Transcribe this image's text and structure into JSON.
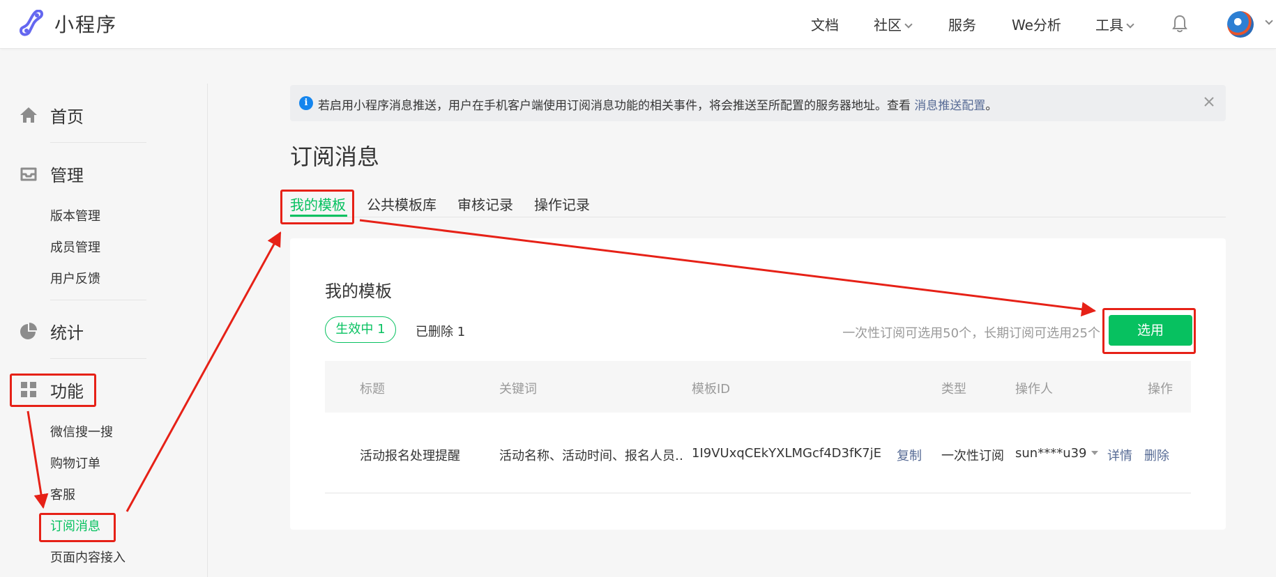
{
  "header": {
    "brand": "小程序",
    "nav": [
      {
        "label": "文档"
      },
      {
        "label": "社区"
      },
      {
        "label": "服务"
      },
      {
        "label": "We分析"
      },
      {
        "label": "工具"
      }
    ]
  },
  "sidebar": {
    "home": "首页",
    "manage": "管理",
    "manage_items": [
      "版本管理",
      "成员管理",
      "用户反馈"
    ],
    "stats": "统计",
    "features": "功能",
    "feature_items": [
      "微信搜一搜",
      "购物订单",
      "客服",
      "订阅消息",
      "页面内容接入"
    ]
  },
  "notice": {
    "text": "若启用小程序消息推送，用户在手机客户端使用订阅消息功能的相关事件，将会推送至所配置的服务器地址。查看 ",
    "link": "消息推送配置",
    "suffix": "。"
  },
  "page": {
    "title": "订阅消息",
    "tabs": [
      "我的模板",
      "公共模板库",
      "审核记录",
      "操作记录"
    ]
  },
  "card": {
    "title": "我的模板",
    "active_filter": "生效中 1",
    "deleted_filter": "已删除 1",
    "limit_note": "一次性订阅可选用50个，长期订阅可选用25个",
    "select_button": "选用",
    "columns": [
      "标题",
      "关键词",
      "模板ID",
      "类型",
      "操作人",
      "操作"
    ],
    "rows": [
      {
        "title": "活动报名处理提醒",
        "keywords": "活动名称、活动时间、报名人员…",
        "template_id": "1I9VUxqCEkYXLMGcf4D3fK7jE…",
        "copy": "复制",
        "type": "一次性订阅",
        "operator": "sun****u39",
        "detail": "详情",
        "delete": "删除"
      }
    ]
  },
  "colors": {
    "accent": "#07c160",
    "link": "#576b95",
    "annotation": "#e62117"
  }
}
